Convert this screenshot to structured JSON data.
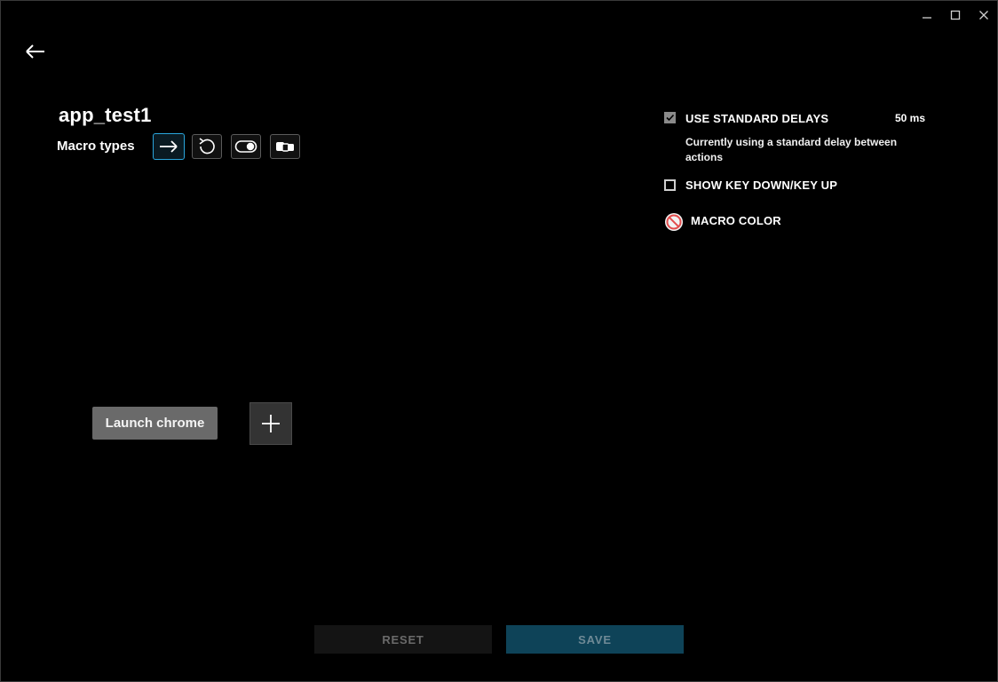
{
  "window": {
    "minimize_icon": "minimize-icon",
    "maximize_icon": "maximize-icon",
    "close_icon": "close-icon"
  },
  "header": {
    "back_icon": "arrow-left-icon"
  },
  "macro": {
    "name": "app_test1",
    "types_label": "Macro types",
    "types": [
      {
        "icon": "arrow-right-icon",
        "selected": true
      },
      {
        "icon": "repeat-icon",
        "selected": false
      },
      {
        "icon": "toggle-icon",
        "selected": false
      },
      {
        "icon": "sequence-icon",
        "selected": false
      }
    ]
  },
  "settings": {
    "standard_delays": {
      "label": "USE STANDARD DELAYS",
      "checked": true,
      "value": "50 ms",
      "description": "Currently using a standard delay between actions"
    },
    "key_down_up": {
      "label": "SHOW KEY DOWN/KEY UP",
      "checked": false
    },
    "macro_color": {
      "label": "MACRO COLOR",
      "icon": "no-color-icon"
    }
  },
  "sequence": {
    "actions": [
      {
        "label": "Launch chrome"
      }
    ],
    "add_icon": "plus-icon"
  },
  "footer": {
    "reset_label": "RESET",
    "save_label": "SAVE"
  },
  "colors": {
    "accent": "#2aa6dd",
    "save_bg": "#0e4358",
    "action_bg": "#6a6a6a",
    "no_color": "#e24c4c"
  }
}
